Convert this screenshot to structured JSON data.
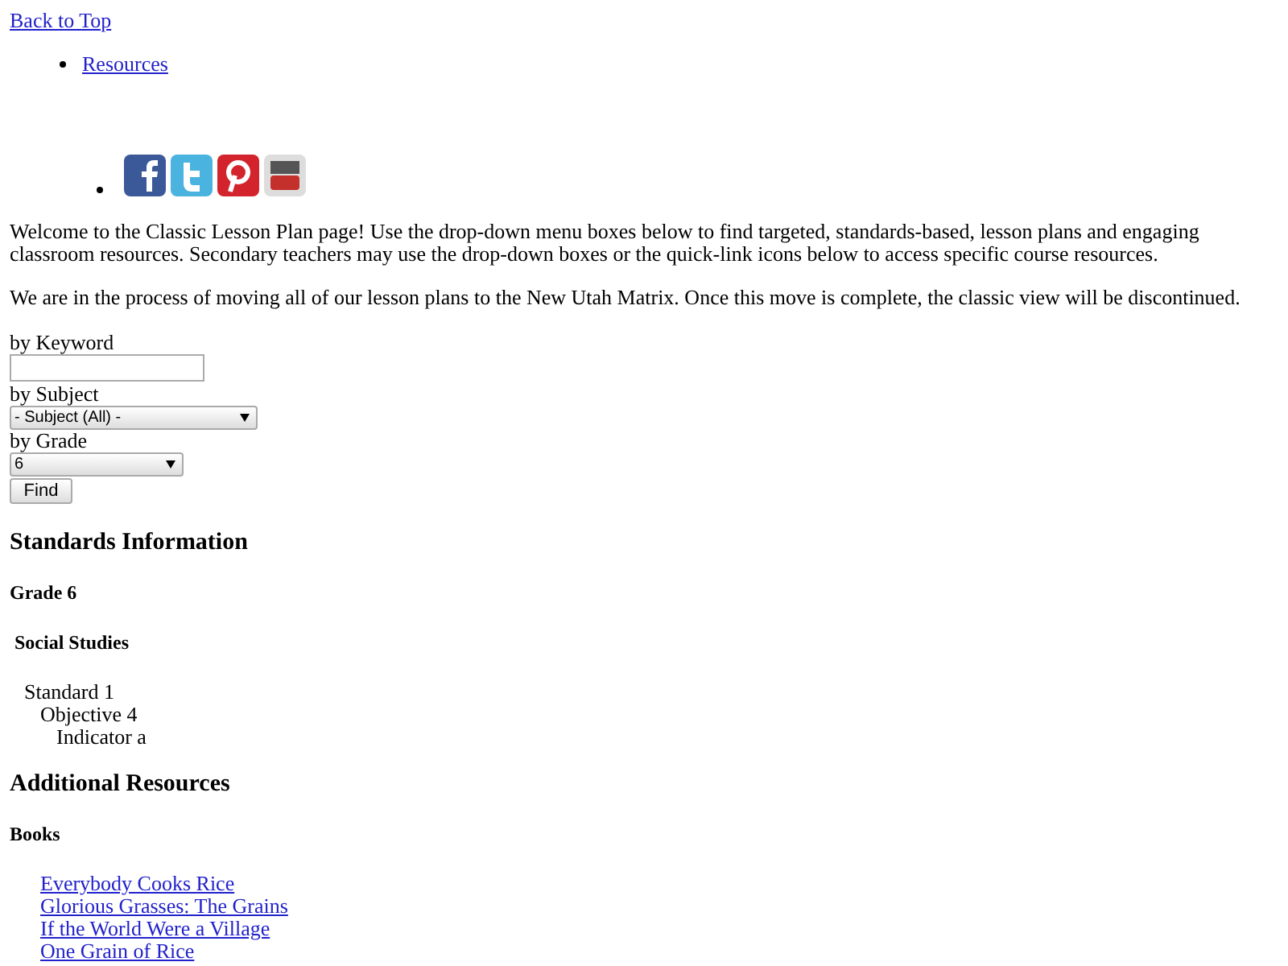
{
  "top_link": "Back to Top",
  "nav": [
    "Resources"
  ],
  "intro": [
    "Welcome to the Classic Lesson Plan page! Use the drop-down menu boxes below to find targeted, standards-based, lesson plans and engaging classroom resources. Secondary teachers may use the drop-down boxes or the quick-link icons below to access specific course resources.",
    "We are in the process of moving all of our lesson plans to the New Utah Matrix. Once this move is complete, the classic view will be discontinued."
  ],
  "search": {
    "keyword_label": "by Keyword",
    "subject_label": "by Subject",
    "subject_value": "- Subject (All) -",
    "grade_label": "by Grade",
    "grade_value": "6",
    "button": "Find"
  },
  "standards": {
    "heading": "Standards Information",
    "grade": "Grade 6",
    "subject": "Social Studies",
    "outline": [
      {
        "label": "Standard 1",
        "children": [
          {
            "label": "Objective 4",
            "children": [
              {
                "label": "Indicator a"
              }
            ]
          }
        ]
      }
    ]
  },
  "resources": {
    "heading": "Additional Resources",
    "section": "Books",
    "links": [
      "Everybody Cooks Rice",
      "Glorious Grasses: The Grains",
      "If the World Were a Village",
      "One Grain of Rice"
    ]
  }
}
